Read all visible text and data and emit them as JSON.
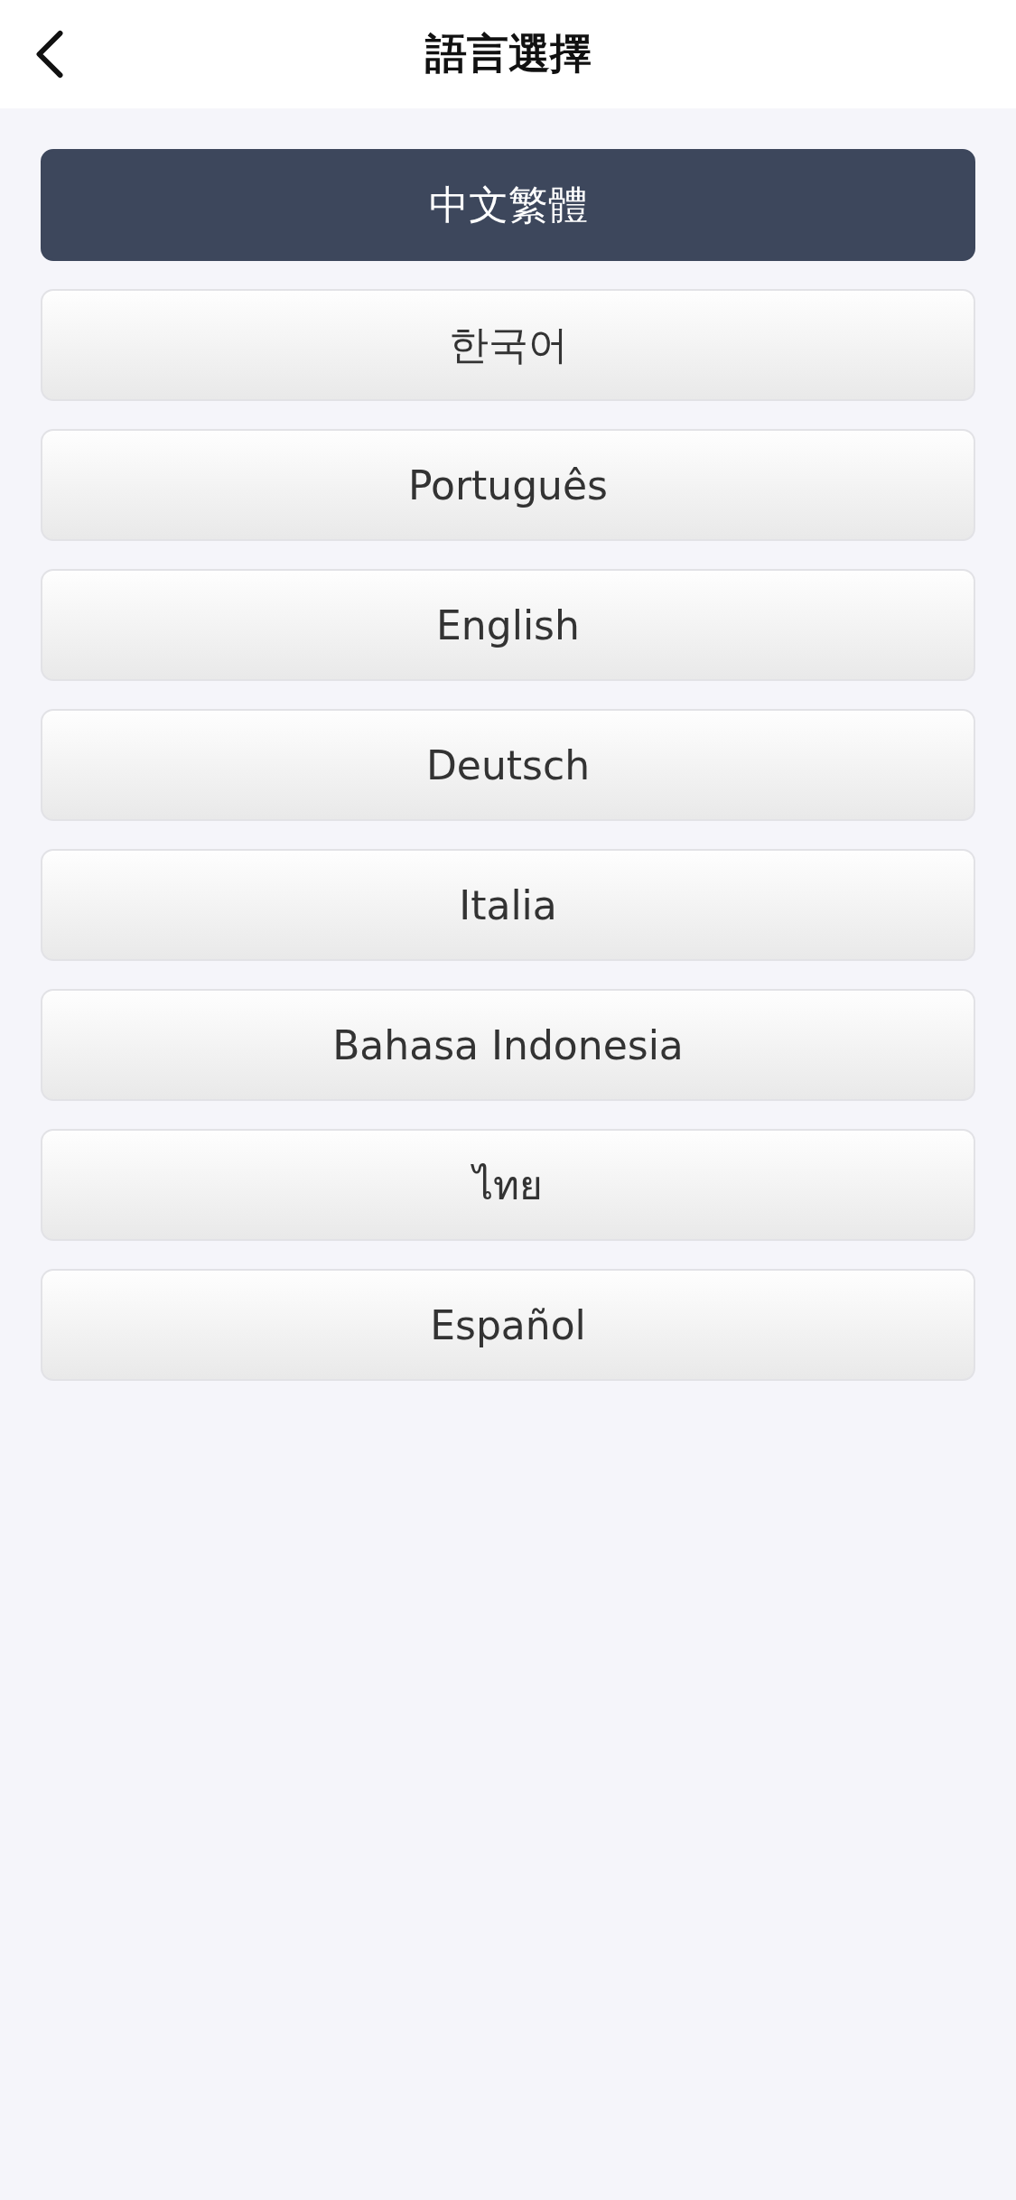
{
  "header": {
    "title": "語言選擇"
  },
  "languages": [
    {
      "label": "中文繁體",
      "selected": true
    },
    {
      "label": "한국어",
      "selected": false
    },
    {
      "label": "Português",
      "selected": false
    },
    {
      "label": "English",
      "selected": false
    },
    {
      "label": "Deutsch",
      "selected": false
    },
    {
      "label": "Italia",
      "selected": false
    },
    {
      "label": "Bahasa Indonesia",
      "selected": false
    },
    {
      "label": "ไทย",
      "selected": false
    },
    {
      "label": "Español",
      "selected": false
    }
  ]
}
